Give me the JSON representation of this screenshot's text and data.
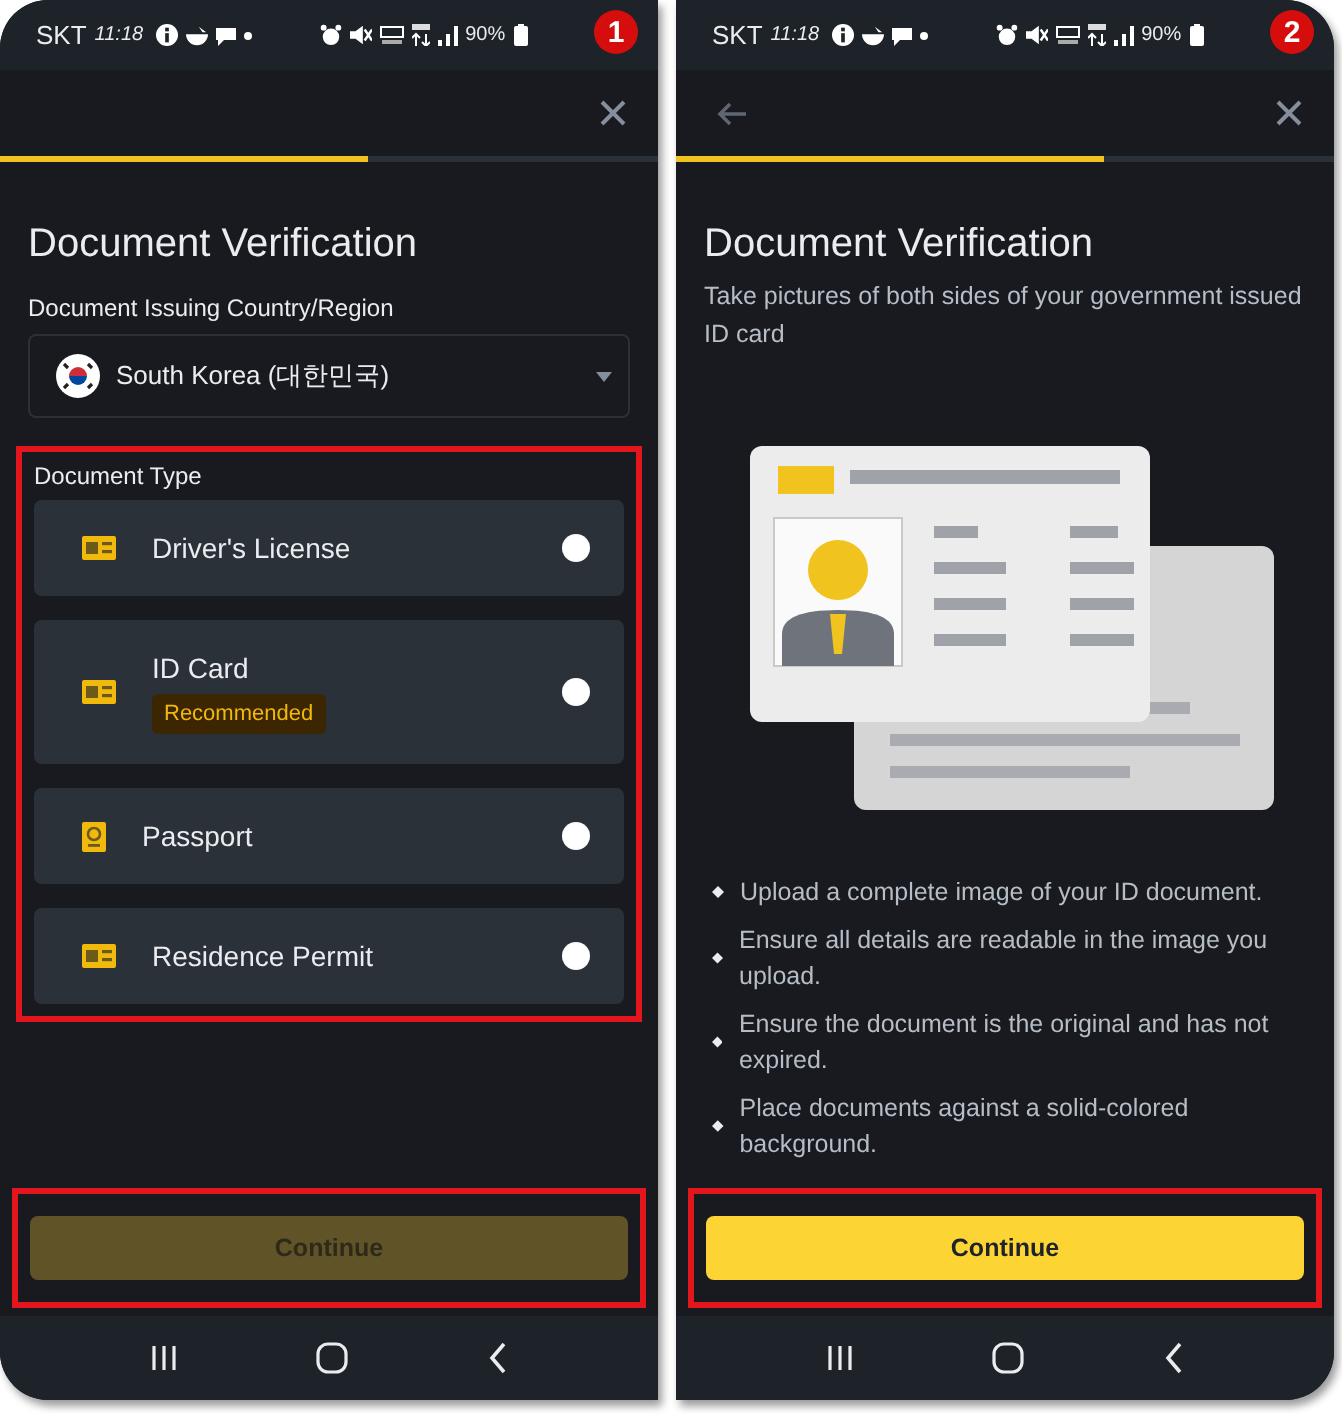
{
  "screens": [
    {
      "badge": "1",
      "status_bar": {
        "carrier": "SKT",
        "time": "11:18",
        "battery": "90%"
      },
      "progress": {
        "level": 0.56
      },
      "title": "Document Verification",
      "country_field": {
        "label": "Document Issuing Country/Region",
        "value": "South Korea (대한민국)"
      },
      "document_type": {
        "label": "Document Type",
        "highlighted": true,
        "options": [
          {
            "label": "Driver's License",
            "kind": "card",
            "selected": false
          },
          {
            "label": "ID Card",
            "kind": "card",
            "selected": false,
            "tag": "Recommended"
          },
          {
            "label": "Passport",
            "kind": "passport",
            "selected": false
          },
          {
            "label": "Residence Permit",
            "kind": "card",
            "selected": false
          }
        ]
      },
      "continue_button": {
        "label": "Continue",
        "disabled": true,
        "highlighted": true
      }
    },
    {
      "badge": "2",
      "status_bar": {
        "carrier": "SKT",
        "time": "11:18",
        "battery": "90%"
      },
      "back_button": true,
      "progress": {
        "level": 0.65
      },
      "title": "Document Verification",
      "subtitle": "Take pictures of both sides of your government issued ID card",
      "tips": [
        "Upload a complete image of your ID document.",
        "Ensure all details are readable in the image you upload.",
        "Ensure the document is the original and has not expired.",
        "Place documents against a solid-colored background."
      ],
      "continue_button": {
        "label": "Continue",
        "disabled": false,
        "highlighted": true
      }
    }
  ]
}
